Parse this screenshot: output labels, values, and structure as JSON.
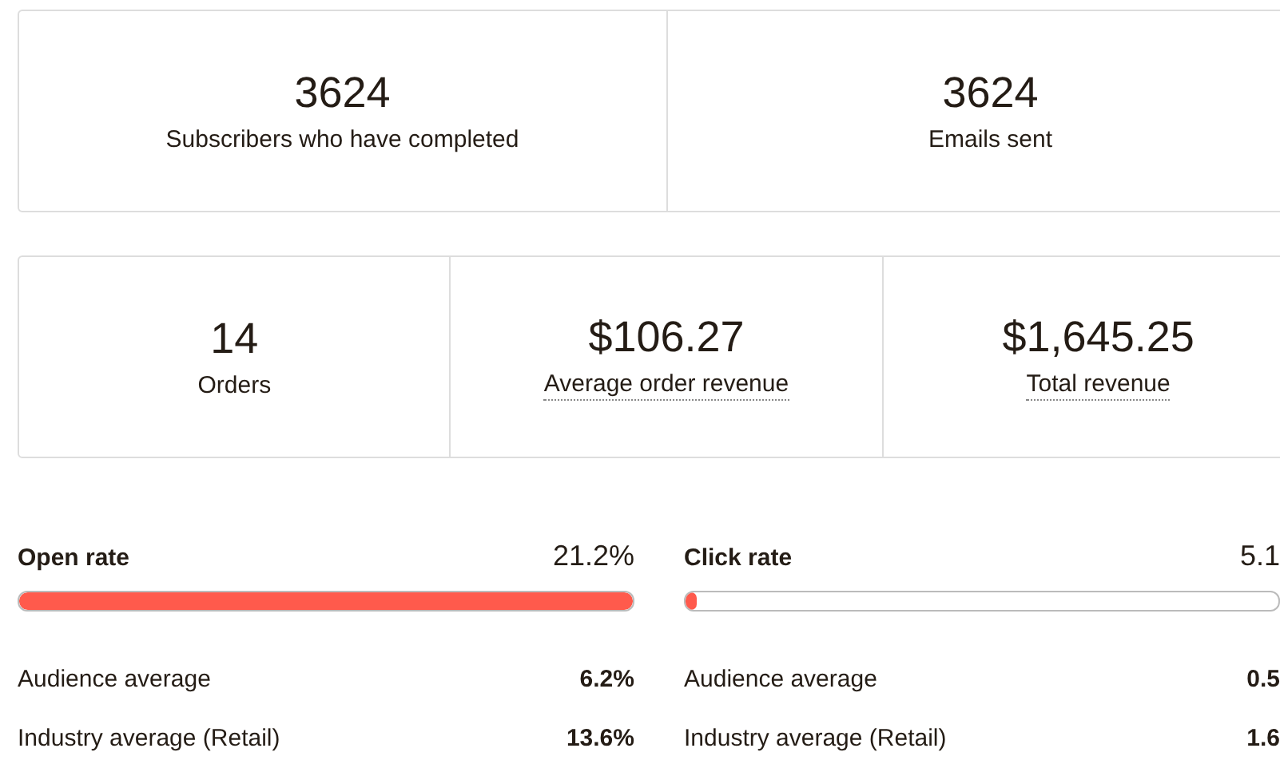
{
  "summary_rows": [
    {
      "stats": [
        {
          "value": "3624",
          "label": "Subscribers who have completed",
          "dotted": false
        },
        {
          "value": "3624",
          "label": "Emails sent",
          "dotted": false
        }
      ]
    },
    {
      "stats": [
        {
          "value": "14",
          "label": "Orders",
          "dotted": false
        },
        {
          "value": "$106.27",
          "label": "Average order revenue",
          "dotted": true
        },
        {
          "value": "$1,645.25",
          "label": "Total revenue",
          "dotted": true
        }
      ]
    }
  ],
  "rates": [
    {
      "title": "Open rate",
      "value": "21.2%",
      "level": 1,
      "averages": [
        {
          "label": "Audience average",
          "value": "6.2%"
        },
        {
          "label": "Industry average (Retail)",
          "value": "13.6%"
        }
      ]
    },
    {
      "title": "Click rate",
      "value": "5.1",
      "level": 0.02,
      "averages": [
        {
          "label": "Audience average",
          "value": "0.5"
        },
        {
          "label": "Industry average (Retail)",
          "value": "1.6"
        }
      ]
    }
  ]
}
